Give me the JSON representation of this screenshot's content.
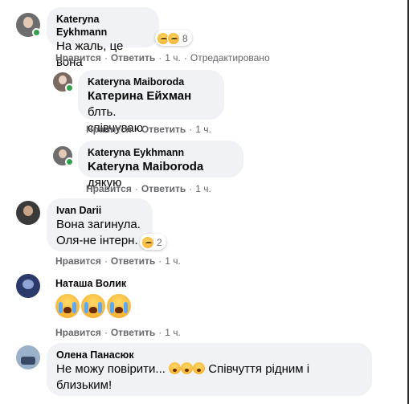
{
  "comments": [
    {
      "author": "Kateryna Eykhmann",
      "text": "На жаль, це вона",
      "reaction_count": "8",
      "actions": {
        "like": "Нравится",
        "reply": "Ответить",
        "time": "1 ч.",
        "edited": "Отредактировано"
      }
    },
    {
      "author": "Kateryna Maiboroda",
      "mention": "Катерина Ейхман",
      "text_after_mention": " блть.",
      "text_line2": "співчуваю",
      "actions": {
        "like": "Нравится",
        "reply": "Ответить",
        "time": "1 ч."
      }
    },
    {
      "author": "Kateryna Eykhmann",
      "mention": "Kateryna Maiboroda",
      "text_after_mention": " дякую",
      "actions": {
        "like": "Нравится",
        "reply": "Ответить",
        "time": "1 ч."
      }
    },
    {
      "author": "Ivan Darii",
      "text_line1": "Вона загинула.",
      "text_line2": "Оля-не інтерн.",
      "reaction_count": "2",
      "actions": {
        "like": "Нравится",
        "reply": "Ответить",
        "time": "1 ч."
      }
    },
    {
      "author": "Наташа Волик",
      "actions": {
        "like": "Нравится",
        "reply": "Ответить",
        "time": "1 ч."
      }
    },
    {
      "author": "Олена Панасюк",
      "text_before": "Не можу повірити... ",
      "text_after": " Співчуття рідним і",
      "text_line2": "близьким!"
    }
  ],
  "colors": {
    "bubble": "#f0f2f5",
    "meta": "#65676b",
    "online": "#31a24c"
  }
}
